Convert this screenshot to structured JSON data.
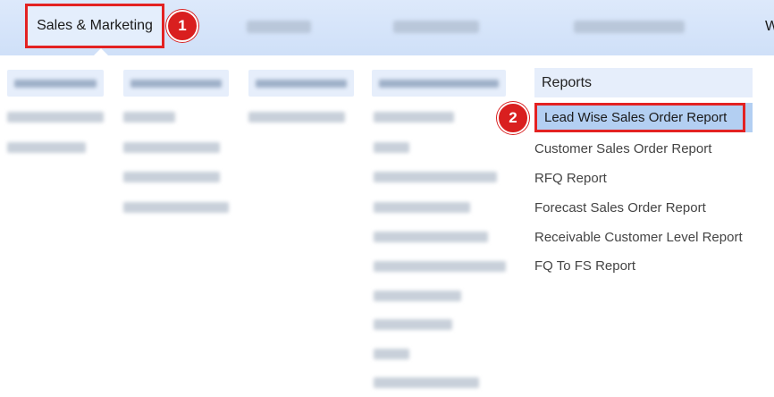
{
  "nav": {
    "active_label": "Sales & Marketing",
    "overflow_label": "W"
  },
  "badges": {
    "one": "1",
    "two": "2"
  },
  "reports": {
    "heading": "Reports",
    "items": [
      "Lead Wise Sales Order Report",
      "Customer Sales Order Report",
      "RFQ Report",
      "Forecast Sales Order Report",
      "Receivable Customer Level Report",
      "FQ To FS Report"
    ]
  },
  "colors": {
    "highlight_border": "#e32222",
    "active_bg": "#b3cff2",
    "topbar": "#cfe0f8"
  }
}
